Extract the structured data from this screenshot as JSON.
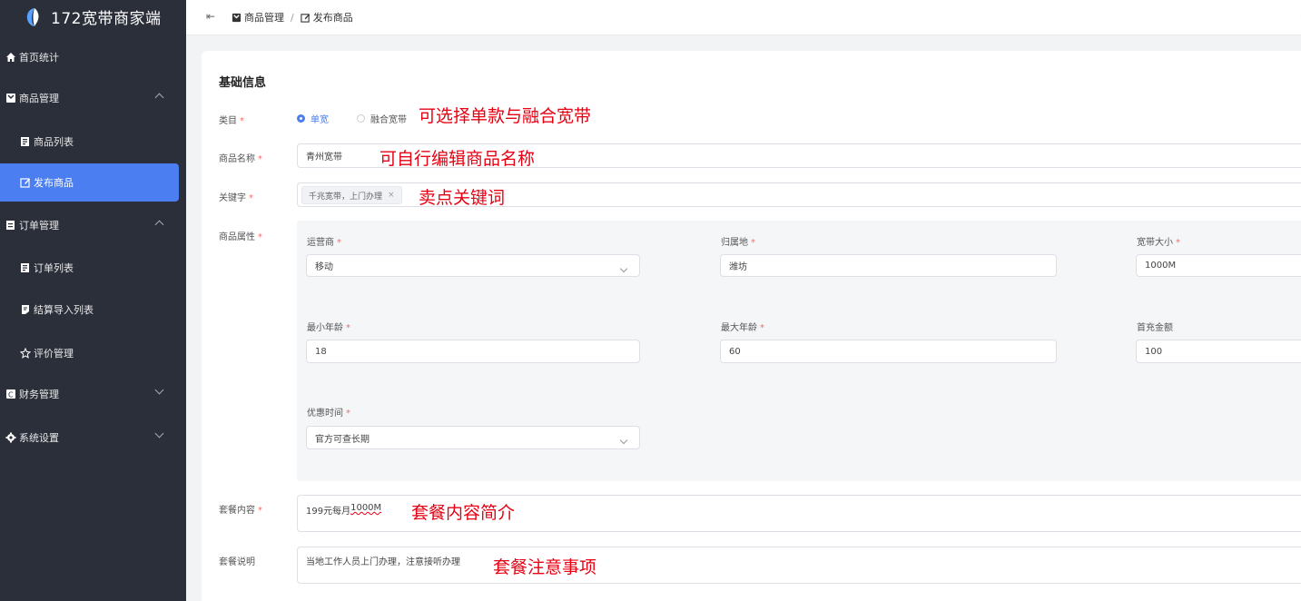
{
  "app": {
    "title": "172宽带商家端",
    "accent": "#4a7ef1",
    "sidebar_bg": "#2b2f3a"
  },
  "sidebar": {
    "items": [
      {
        "label": "首页统计",
        "icon": "home-icon"
      },
      {
        "label": "商品管理",
        "icon": "goods-icon",
        "expanded": true
      },
      {
        "label": "商品列表",
        "icon": "list-icon"
      },
      {
        "label": "发布商品",
        "icon": "edit-icon",
        "active": true
      },
      {
        "label": "订单管理",
        "icon": "order-icon",
        "expanded": true
      },
      {
        "label": "订单列表",
        "icon": "list-icon"
      },
      {
        "label": "结算导入列表",
        "icon": "settle-icon"
      },
      {
        "label": "评价管理",
        "icon": "star-icon"
      },
      {
        "label": "财务管理",
        "icon": "finance-icon",
        "expanded": false
      },
      {
        "label": "系统设置",
        "icon": "gear-icon",
        "expanded": false
      }
    ]
  },
  "breadcrumb": {
    "parent": "商品管理",
    "separator": "/",
    "current": "发布商品"
  },
  "form": {
    "section_title": "基础信息",
    "required_mark": "*",
    "category": {
      "label": "类目",
      "options": [
        "单宽",
        "融合宽带"
      ],
      "selected": "单宽"
    },
    "name": {
      "label": "商品名称",
      "value": "青州宽带"
    },
    "keywords": {
      "label": "关键字",
      "tag": "千兆宽带，上门办理",
      "tag_close": "×"
    },
    "attributes": {
      "label": "商品属性",
      "operator": {
        "label": "运营商",
        "value": "移动"
      },
      "location": {
        "label": "归属地",
        "value": "潍坊"
      },
      "bandwidth": {
        "label": "宽带大小",
        "value": "1000M"
      },
      "min_age": {
        "label": "最小年龄",
        "value": "18"
      },
      "max_age": {
        "label": "最大年龄",
        "value": "60"
      },
      "first_charge": {
        "label": "首充金额",
        "value": "100"
      },
      "promo_time": {
        "label": "优惠时间",
        "value": "官方可查长期"
      }
    },
    "package_content": {
      "label": "套餐内容",
      "value_prefix": "199元每月",
      "value_mark": "1000M"
    },
    "package_desc": {
      "label": "套餐说明",
      "value": "当地工作人员上门办理，注意接听办理"
    }
  },
  "annotations": {
    "category": "可选择单款与融合宽带",
    "name": "可自行编辑商品名称",
    "keywords": "卖点关键词",
    "content": "套餐内容简介",
    "desc": "套餐注意事项",
    "color": "#e60012"
  }
}
